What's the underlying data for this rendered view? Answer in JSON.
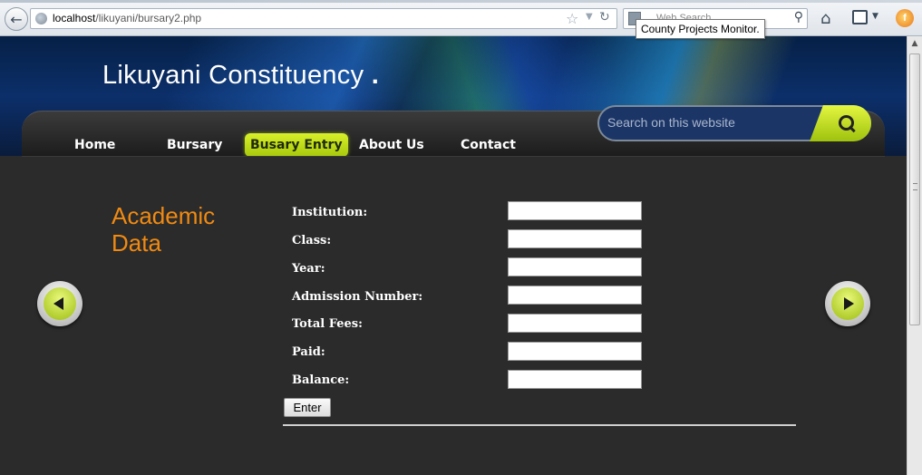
{
  "browser": {
    "url_host": "localhost",
    "url_path": "/likuyani/bursary2.php",
    "search_placeholder": "Web Search",
    "tooltip": "County Projects Monitor.",
    "firefox_glyph": "f"
  },
  "site": {
    "title": "Likuyani Constituency",
    "title_dot": "."
  },
  "nav": {
    "items": [
      {
        "label": "Home",
        "active": false
      },
      {
        "label": "Bursary",
        "active": false
      },
      {
        "label": "Busary Entry",
        "active": true
      },
      {
        "label": "About Us",
        "active": false
      },
      {
        "label": "Contact",
        "active": false
      }
    ],
    "search_placeholder": "Search on this website"
  },
  "form": {
    "section_title": "Academic Data",
    "fields": [
      {
        "label": "Institution:",
        "value": ""
      },
      {
        "label": "Class:",
        "value": ""
      },
      {
        "label": "Year:",
        "value": ""
      },
      {
        "label": "Admission Number:",
        "value": ""
      },
      {
        "label": "Total Fees:",
        "value": ""
      },
      {
        "label": "Paid:",
        "value": ""
      },
      {
        "label": "Balance:",
        "value": ""
      }
    ],
    "submit_label": "Enter"
  },
  "colors": {
    "accent_green": "#b9d81a",
    "title_orange": "#f08a12",
    "page_bg": "#2b2b2b"
  }
}
